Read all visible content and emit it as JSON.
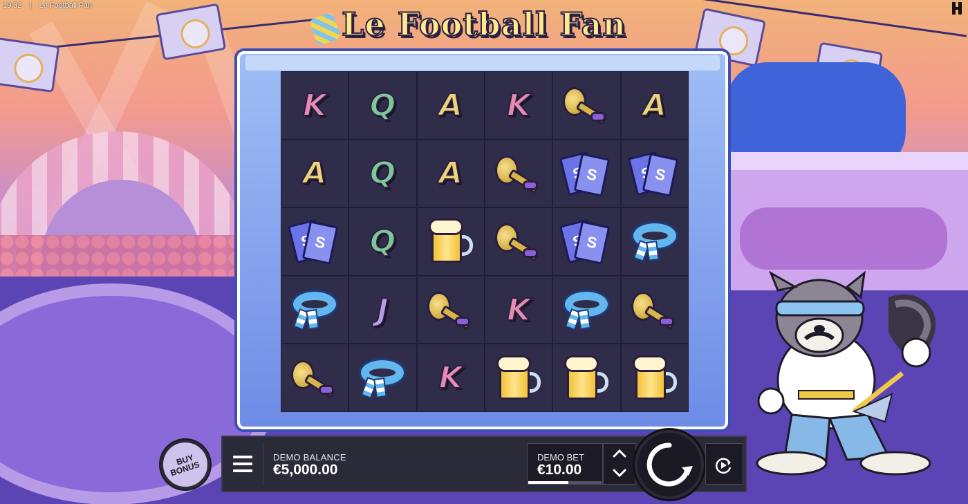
{
  "window": {
    "time": "19:32",
    "separator": "|",
    "title": "Le Football Fan"
  },
  "game": {
    "logo_text": "Le Football Fan"
  },
  "reels": [
    [
      "K",
      "Q",
      "A",
      "K",
      "horn",
      "A"
    ],
    [
      "A",
      "Q",
      "A",
      "horn",
      "ticket",
      "ticket"
    ],
    [
      "ticket",
      "Q",
      "beer",
      "horn",
      "ticket",
      "scarf"
    ],
    [
      "scarf",
      "J",
      "horn",
      "K",
      "scarf",
      "horn"
    ],
    [
      "horn",
      "scarf",
      "K",
      "beer",
      "beer",
      "beer"
    ]
  ],
  "symbol_icons": {
    "horn": "vuvuzela-horn-icon",
    "ticket": "ticket-icon",
    "beer": "beer-mug-icon",
    "scarf": "scarf-icon"
  },
  "ticket_mark": "S",
  "controls": {
    "buy_bonus_line1": "BUY",
    "buy_bonus_line2": "BONUS",
    "balance_label": "DEMO BALANCE",
    "balance_value": "€5,000.00",
    "bet_label": "DEMO BET",
    "bet_value": "€10.00",
    "bet_level_fraction": 0.55,
    "bet_up": "⌃",
    "bet_down": "⌄"
  },
  "colors": {
    "panel": "#2b2a38",
    "accent_text": "#ffffff",
    "grid_bg": "#302d4a"
  }
}
